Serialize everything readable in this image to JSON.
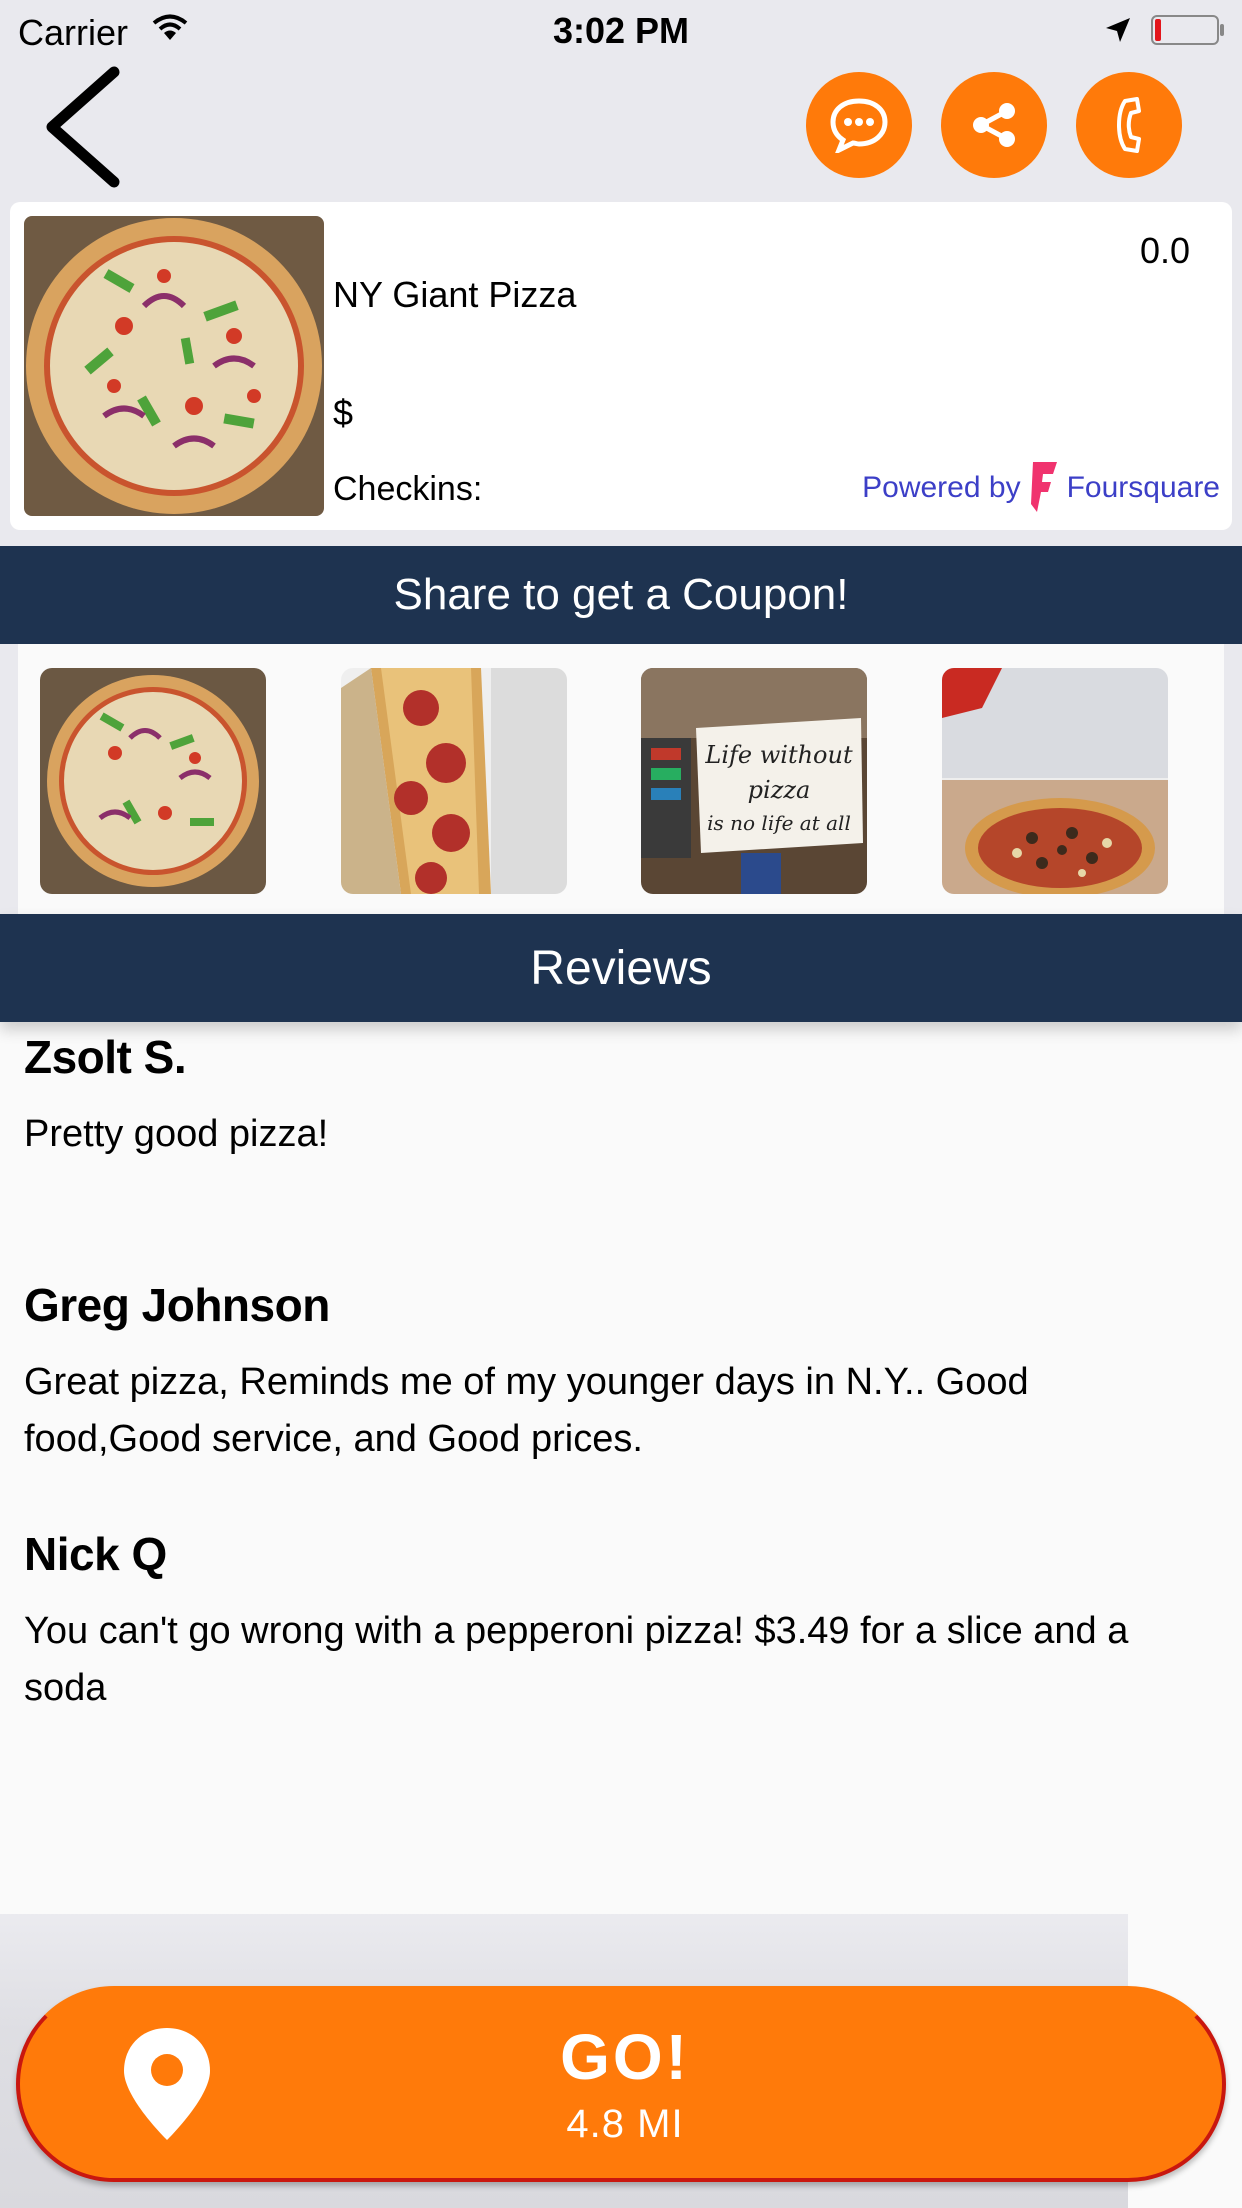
{
  "status_bar": {
    "carrier": "Carrier",
    "time": "3:02 PM"
  },
  "header": {
    "back_icon": "chevron-left-icon",
    "actions": [
      {
        "icon": "chat-bubble-icon"
      },
      {
        "icon": "share-icon"
      },
      {
        "icon": "phone-icon"
      }
    ],
    "accent_color": "#ff7a0a"
  },
  "venue": {
    "name": "NY Giant Pizza",
    "rating": "0.0",
    "price": "$",
    "checkins_label": "Checkins:",
    "powered_by": "Powered by",
    "provider": "Foursquare"
  },
  "coupon_banner": {
    "label": "Share to get a Coupon!",
    "color": "#1e3350"
  },
  "gallery": {
    "photos": [
      {
        "icon": "pizza-photo"
      },
      {
        "icon": "pepperoni-slice-photo"
      },
      {
        "icon": "sign-photo",
        "caption_lines": [
          "Life without",
          "pizza",
          "is no life at all"
        ]
      },
      {
        "icon": "storefront-pizza-photo"
      }
    ]
  },
  "reviews": {
    "title": "Reviews",
    "items": [
      {
        "author": "Zsolt S.",
        "text": "Pretty good pizza!"
      },
      {
        "author": "Greg Johnson",
        "text": "Great pizza, Reminds me of my younger days in N.Y.. Good food,Good service, and Good prices."
      },
      {
        "author": "Nick Q",
        "text": "You can't go wrong with a pepperoni pizza! $3.49 for a slice and a soda"
      }
    ]
  },
  "go_button": {
    "label": "GO!",
    "distance": "4.8 MI",
    "icon": "map-pin-icon"
  }
}
